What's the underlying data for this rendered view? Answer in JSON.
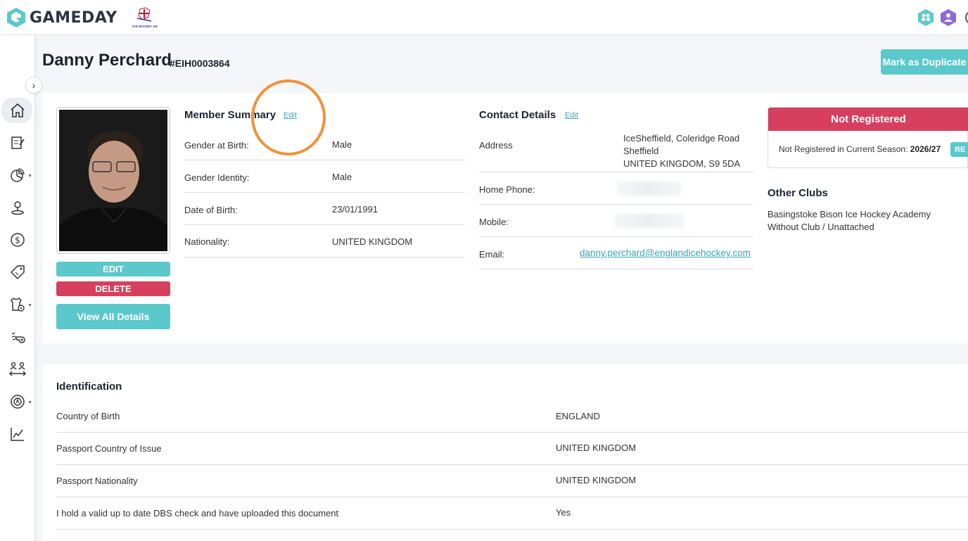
{
  "brand": {
    "name": "GAMEDAY",
    "accent": "#5bc9cc",
    "danger": "#d6405e"
  },
  "org_logo": {
    "name": "ice-hockey-uk-logo",
    "text": "ICE HOCKEY UK"
  },
  "top_icons": [
    "people-hex-icon",
    "user-shield-icon",
    "circle-icon"
  ],
  "sidebar": {
    "items": [
      {
        "icon": "home-icon",
        "active": true
      },
      {
        "icon": "form-edit-icon"
      },
      {
        "icon": "pie-chart-icon",
        "caret": true
      },
      {
        "icon": "user-location-icon"
      },
      {
        "icon": "dollar-icon"
      },
      {
        "icon": "tag-icon"
      },
      {
        "icon": "jersey-settings-icon",
        "caret": true
      },
      {
        "icon": "whistle-icon"
      },
      {
        "icon": "transfer-people-icon"
      },
      {
        "icon": "target-icon",
        "caret": true
      },
      {
        "icon": "line-chart-icon"
      }
    ]
  },
  "header": {
    "name": "Danny Perchard",
    "id": "#EIH0003864",
    "duplicate_button": "Mark as Duplicate"
  },
  "profile": {
    "edit": "EDIT",
    "delete": "DELETE",
    "view_all": "View All Details"
  },
  "member_summary": {
    "title": "Member Summary",
    "edit": "Edit",
    "rows": [
      {
        "label": "Gender at Birth:",
        "value": "Male"
      },
      {
        "label": "Gender Identity:",
        "value": "Male"
      },
      {
        "label": "Date of Birth:",
        "value": "23/01/1991"
      },
      {
        "label": "Nationality:",
        "value": "UNITED KINGDOM"
      }
    ]
  },
  "contact": {
    "title": "Contact Details",
    "edit": "Edit",
    "address_label": "Address",
    "address_lines": [
      "IceSheffield, Coleridge Road",
      "Sheffield",
      "UNITED KINGDOM,  S9 5DA"
    ],
    "home_phone_label": "Home Phone:",
    "mobile_label": "Mobile:",
    "email_label": "Email:",
    "email": "danny.perchard@englandicehockey.com"
  },
  "registration": {
    "status": "Not Registered",
    "text": "Not Registered in Current Season:",
    "season": "2026/27",
    "button": "RE"
  },
  "other_clubs": {
    "title": "Other Clubs",
    "clubs": [
      "Basingstoke Bison Ice Hockey Academy",
      "Without Club / Unattached"
    ]
  },
  "identification": {
    "title": "Identification",
    "rows": [
      {
        "label": "Country of Birth",
        "value": "ENGLAND"
      },
      {
        "label": "Passport Country of Issue",
        "value": "UNITED KINGDOM"
      },
      {
        "label": "Passport Nationality",
        "value": "UNITED KINGDOM"
      },
      {
        "label": "I hold a valid up to date DBS check and have uploaded this document",
        "value": "Yes"
      }
    ]
  }
}
